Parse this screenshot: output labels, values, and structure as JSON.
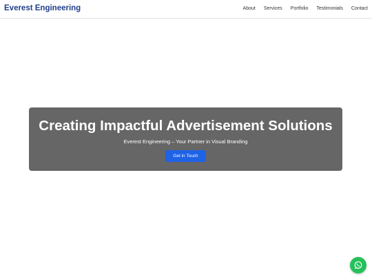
{
  "header": {
    "brand": "Everest Engineering",
    "nav": [
      {
        "label": "About"
      },
      {
        "label": "Services"
      },
      {
        "label": "Portfolio"
      },
      {
        "label": "Testimonials"
      },
      {
        "label": "Contact"
      }
    ]
  },
  "hero": {
    "title": "Creating Impactful Advertisement Solutions",
    "subtitle": "Everest Engineering – Your Partner in Visual Branding",
    "cta_label": "Get in Touch"
  },
  "floating": {
    "whatsapp_icon": "whatsapp-icon"
  },
  "colors": {
    "brand": "#1f3f8a",
    "hero_background": "#666666",
    "cta": "#1e62e6",
    "whatsapp": "#25c05c"
  }
}
